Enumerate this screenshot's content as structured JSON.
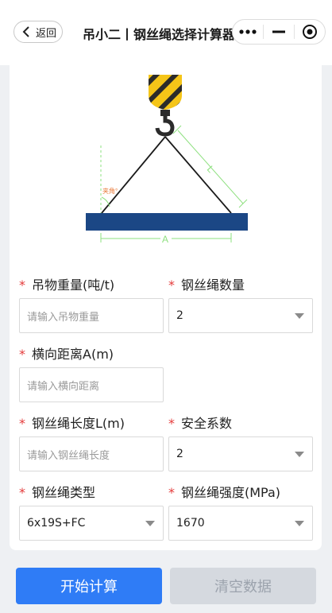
{
  "header": {
    "back_label": "返回",
    "title": "吊小二丨钢丝绳选择计算器",
    "menu_icon": "more-dots-icon",
    "minimize_icon": "minimize-icon",
    "close_icon": "target-close-icon"
  },
  "diagram": {
    "length_label": "L",
    "width_label": "A",
    "angle_label": "夹角°",
    "colors": {
      "hook_yellow": "#f5c518",
      "hook_dark": "#2b2b2b",
      "beam": "#1b4785",
      "dimension": "#8ee07f",
      "angle": "#e87a3a"
    }
  },
  "form": {
    "weight": {
      "label": "吊物重量(吨/t)",
      "placeholder": "请输入吊物重量"
    },
    "rope_count": {
      "label": "钢丝绳数量",
      "value": "2"
    },
    "distance": {
      "label": "横向距离A(m)",
      "placeholder": "请输入横向距离"
    },
    "rope_length": {
      "label": "钢丝绳长度L(m)",
      "placeholder": "请输入钢丝绳长度"
    },
    "safety_factor": {
      "label": "安全系数",
      "value": "2"
    },
    "rope_type": {
      "label": "钢丝绳类型",
      "value": "6x19S+FC"
    },
    "rope_strength": {
      "label": "钢丝绳强度(MPa)",
      "value": "1670"
    }
  },
  "required_mark": "*",
  "buttons": {
    "calculate": "开始计算",
    "clear": "清空数据"
  },
  "colors": {
    "primary": "#2f7cf6",
    "required": "#e43a3a"
  }
}
